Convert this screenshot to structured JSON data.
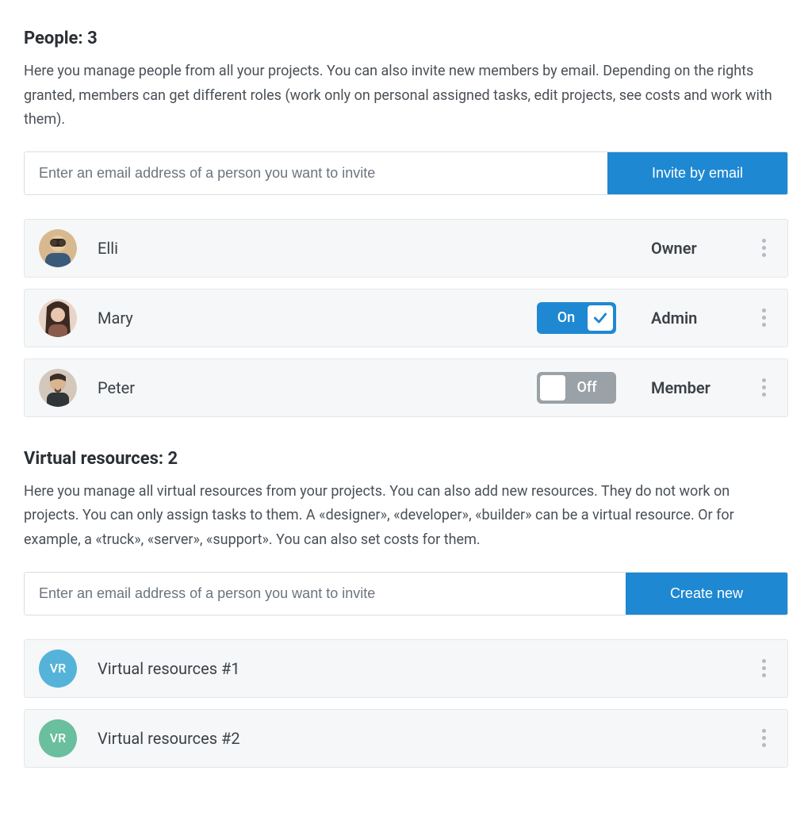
{
  "people": {
    "title": "People: 3",
    "description": "Here you manage people from all your projects. You can also invite new members by email. Depending on the rights granted, members can get different roles (work only on personal assigned tasks, edit projects, see costs and work with them).",
    "input_placeholder": "Enter an email address of a person you want to invite",
    "button_label": "Invite by email",
    "toggle_on_label": "On",
    "toggle_off_label": "Off",
    "members": [
      {
        "name": "Elli",
        "role": "Owner",
        "toggle": null
      },
      {
        "name": "Mary",
        "role": "Admin",
        "toggle": "on"
      },
      {
        "name": "Peter",
        "role": "Member",
        "toggle": "off"
      }
    ]
  },
  "virtual": {
    "title": "Virtual resources: 2",
    "description": "Here you manage all virtual resources from your projects. You can also add new resources. They do not work on projects. You can only assign tasks to them. A «designer», «developer», «builder» can be a virtual resource. Or for example, a «truck», «server», «support». You can also set costs for them.",
    "input_placeholder": "Enter an email address of a person you want to invite",
    "button_label": "Create new",
    "badge_text": "VR",
    "items": [
      {
        "name": "Virtual resources #1",
        "color": "#55b3d9"
      },
      {
        "name": "Virtual resources #2",
        "color": "#6abf9e"
      }
    ]
  }
}
